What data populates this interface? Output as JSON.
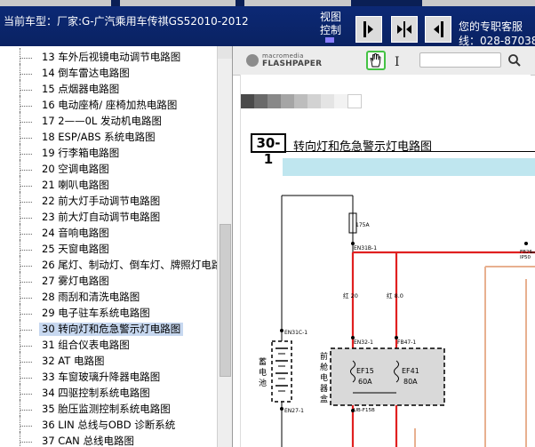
{
  "header": {
    "car_model": "当前车型：厂家:G-广汽乘用车传祺GS52010-2012",
    "view_label": "视图控制",
    "service_line1": "您的专职客服",
    "service_line2": "线：028-87038",
    "buttons": [
      {
        "name": "view-left-button",
        "icon": "panel-left-icon"
      },
      {
        "name": "view-split-button",
        "icon": "panel-split-icon"
      },
      {
        "name": "view-right-button",
        "icon": "panel-right-icon"
      }
    ]
  },
  "tree": {
    "items": [
      {
        "label": "13 车外后视镜电动调节电路图"
      },
      {
        "label": "14 倒车雷达电路图"
      },
      {
        "label": "15 点烟器电路图"
      },
      {
        "label": "16 电动座椅/ 座椅加热电路图"
      },
      {
        "label": "17 2——0L 发动机电路图"
      },
      {
        "label": "18 ESP/ABS 系统电路图"
      },
      {
        "label": "19 行李箱电路图"
      },
      {
        "label": "20 空调电路图"
      },
      {
        "label": "21 喇叭电路图"
      },
      {
        "label": "22 前大灯手动调节电路图"
      },
      {
        "label": "23 前大灯自动调节电路图"
      },
      {
        "label": "24 音响电路图"
      },
      {
        "label": "25 天窗电路图"
      },
      {
        "label": "26 尾灯、制动灯、倒车灯、牌照灯电路"
      },
      {
        "label": "27 雾灯电路图"
      },
      {
        "label": "28 雨刮和清洗电路图"
      },
      {
        "label": "29 电子驻车系统电路图"
      },
      {
        "label": "30 转向灯和危急警示灯电路图",
        "selected": true
      },
      {
        "label": "31 组合仪表电路图"
      },
      {
        "label": "32 AT 电路图"
      },
      {
        "label": "33 车窗玻璃升降器电路图"
      },
      {
        "label": "34 四驱控制系统电路图"
      },
      {
        "label": "35 胎压监测控制系统电路图"
      },
      {
        "label": "36 LIN 总线与OBD 诊断系统"
      },
      {
        "label": "37 CAN 总线电路图"
      }
    ]
  },
  "viewer": {
    "logo_line1": "macromedia",
    "logo_line2": "FLASHPAPER",
    "cursor_glyph": "I",
    "search_value": "",
    "swatch_colors": [
      "#4a4a4a",
      "#6a6a6a",
      "#888888",
      "#a5a5a5",
      "#bdbdbd",
      "#d2d2d2",
      "#e4e4e4",
      "#f2f2f2",
      "#ffffff"
    ],
    "section_number": "30-1",
    "section_title": "转向灯和危急警示灯电路图",
    "schematic": {
      "battery_label": "蓄电池",
      "fusebox_label": "前舱电器盒",
      "fuse_175a": "175A",
      "conn_en31b": "EN31B-1",
      "conn_en31c": "EN31C-1",
      "conn_en32": "EN32-1",
      "conn_fb47": "FB47-1",
      "conn_en27": "EN27-1",
      "conn_ub": "UB-F15B",
      "wire_left": "红 20",
      "wire_right": "红 8.0",
      "ef15": "EF15",
      "ef15_amp": "60A",
      "ef41": "EF41",
      "ef41_amp": "80A",
      "right_conn1": "FB26",
      "right_conn2": "IP50"
    }
  }
}
